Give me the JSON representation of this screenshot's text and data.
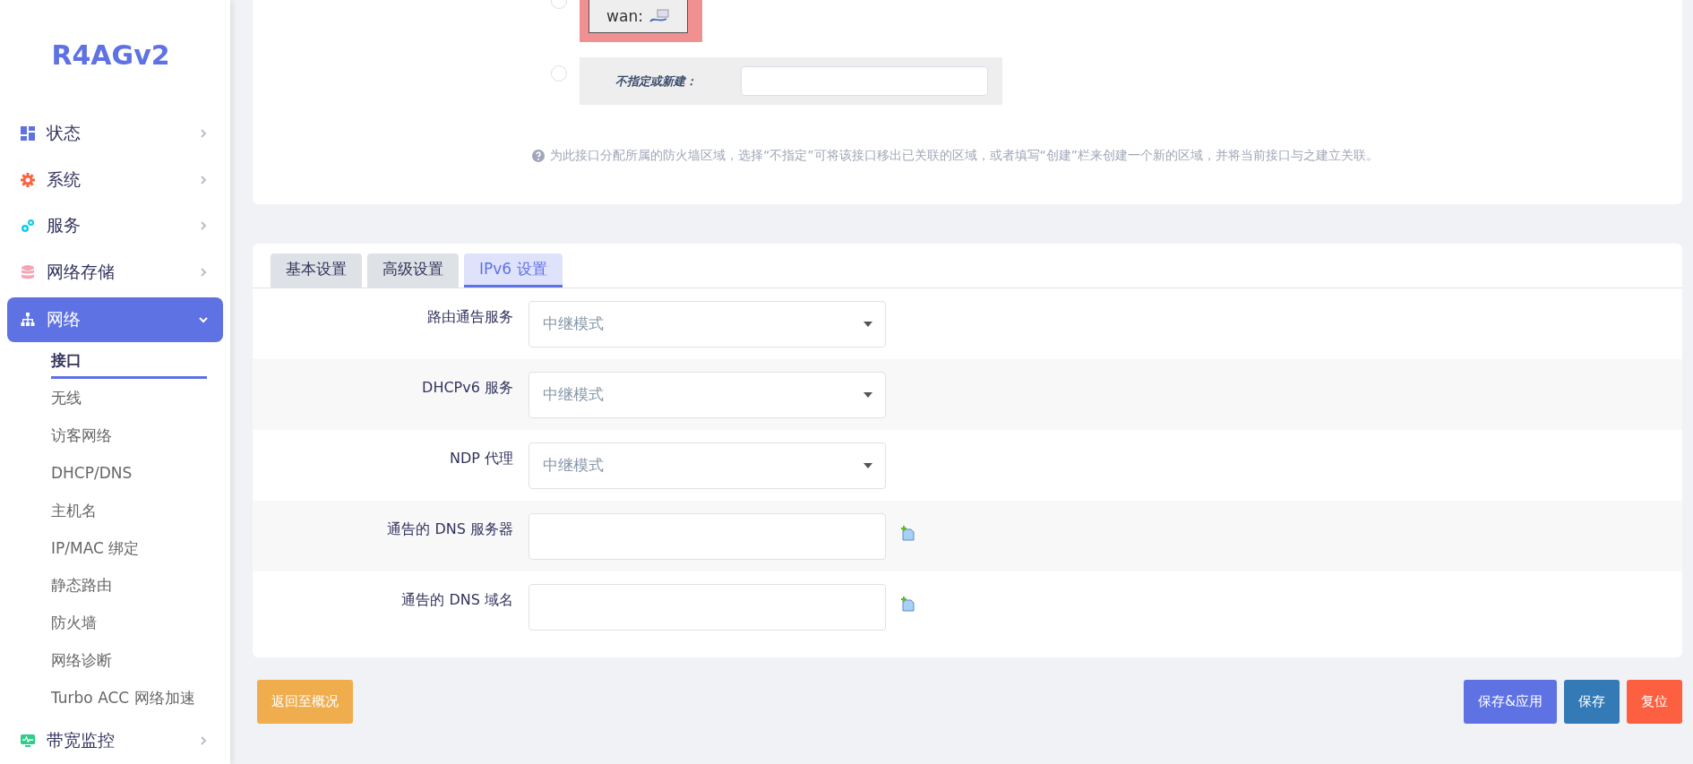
{
  "sidebar": {
    "logo": "R4AGv2",
    "items": [
      {
        "kind": "dashboard",
        "label": "状态",
        "selected": false,
        "expanded": false
      },
      {
        "kind": "gear",
        "label": "系统",
        "selected": false,
        "expanded": false
      },
      {
        "kind": "gears",
        "label": "服务",
        "selected": false,
        "expanded": false
      },
      {
        "kind": "database",
        "label": "网络存储",
        "selected": false,
        "expanded": false
      },
      {
        "kind": "sitemap",
        "label": "网络",
        "selected": true,
        "expanded": true,
        "children": [
          {
            "label": "接口",
            "selected": true
          },
          {
            "label": "无线",
            "selected": false
          },
          {
            "label": "访客网络",
            "selected": false
          },
          {
            "label": "DHCP/DNS",
            "selected": false
          },
          {
            "label": "主机名",
            "selected": false
          },
          {
            "label": "IP/MAC 绑定",
            "selected": false
          },
          {
            "label": "静态路由",
            "selected": false
          },
          {
            "label": "防火墙",
            "selected": false
          },
          {
            "label": "网络诊断",
            "selected": false
          },
          {
            "label": "Turbo ACC 网络加速",
            "selected": false
          }
        ]
      },
      {
        "kind": "monitor",
        "label": "带宽监控",
        "selected": false,
        "expanded": false
      }
    ]
  },
  "firewall_zone": {
    "options": [
      {
        "kind": "zone",
        "label": "wan:",
        "selected": false,
        "color": "#f09090"
      },
      {
        "kind": "create",
        "label": "不指定或新建：",
        "selected": false
      }
    ],
    "help": "为此接口分配所属的防火墙区域，选择“不指定”可将该接口移出已关联的区域，或者填写“创建”栏来创建一个新的区域，并将当前接口与之建立关联。"
  },
  "tabs": [
    {
      "label": "基本设置",
      "selected": false
    },
    {
      "label": "高级设置",
      "selected": false
    },
    {
      "label": "IPv6 设置",
      "selected": true
    }
  ],
  "fields": [
    {
      "kind": "select",
      "label": "路由通告服务",
      "value": "中继模式"
    },
    {
      "kind": "select",
      "label": "DHCPv6 服务",
      "value": "中继模式"
    },
    {
      "kind": "select",
      "label": "NDP 代理",
      "value": "中继模式"
    },
    {
      "kind": "list",
      "label": "通告的 DNS 服务器"
    },
    {
      "kind": "list",
      "label": "通告的 DNS 域名"
    }
  ],
  "buttons": [
    {
      "kind": "back",
      "label": "返回至概况"
    },
    {
      "kind": "apply",
      "label": "保存&应用"
    },
    {
      "kind": "save",
      "label": "保存"
    },
    {
      "kind": "reset",
      "label": "复位"
    }
  ]
}
